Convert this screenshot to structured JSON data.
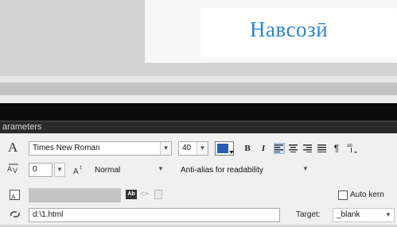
{
  "stage": {
    "title": "Навсозӣ"
  },
  "panel": {
    "header": "arameters"
  },
  "text_tools": {
    "type_icon": "A",
    "font_family": "Times New Roman",
    "font_size": "40",
    "fill_color": "#2a5bb5",
    "bold_label": "B",
    "italic_label": "I",
    "paragraph_label": "¶",
    "letter_spacing": "0",
    "char_position": "Normal",
    "anti_alias": "Anti-alias for readability"
  },
  "link_tools": {
    "selectable_icon": "Ab",
    "auto_kern_label": "Auto kern",
    "url": "d:\\1.html",
    "target_label": "Target:",
    "target_value": "_blank"
  }
}
